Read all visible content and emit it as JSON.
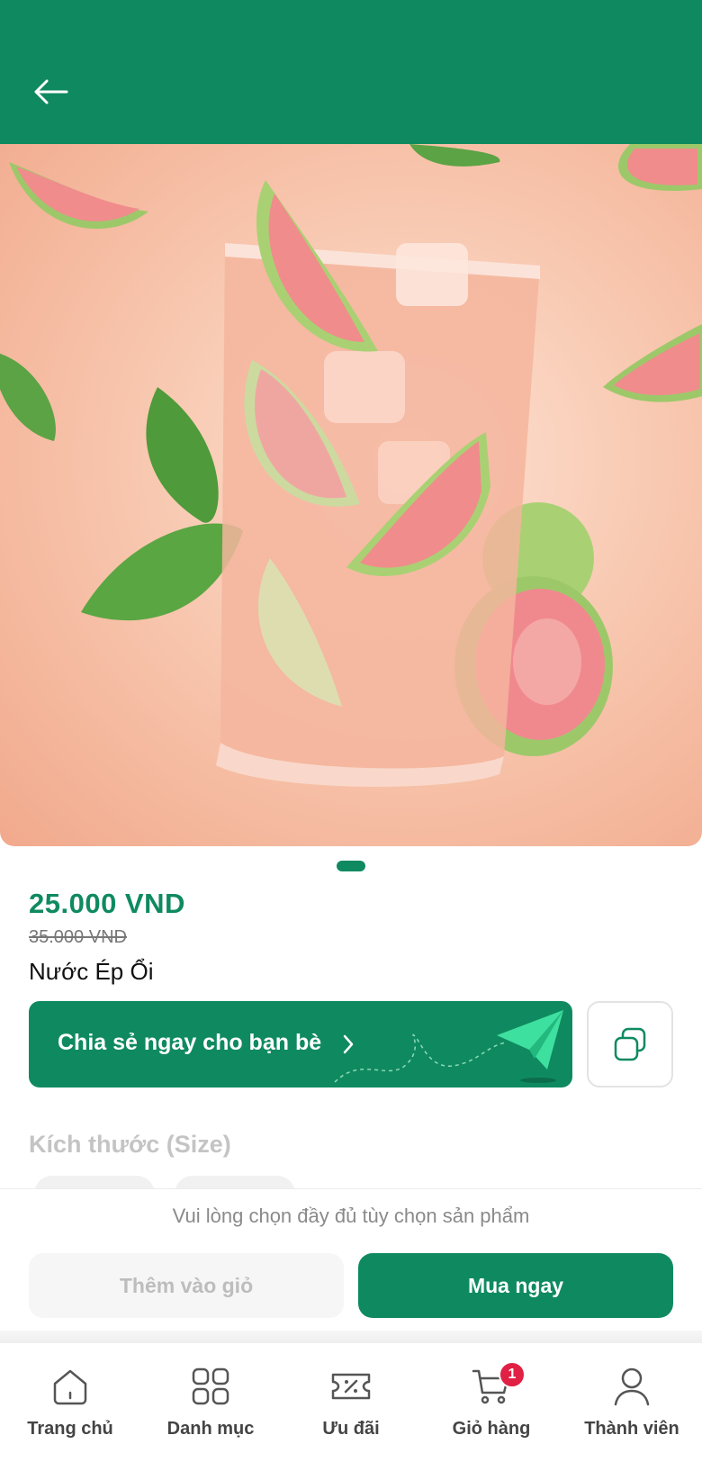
{
  "header": {
    "back_icon": "arrow-left-icon"
  },
  "product": {
    "image_alt": "Guava juice glass with guava slices",
    "price": "25.000 VND",
    "old_price": "35.000 VND",
    "name": "Nước Ép Ổi"
  },
  "share": {
    "label": "Chia sẻ ngay cho bạn bè",
    "icon": "paper-plane-icon",
    "copy_icon": "copy-icon"
  },
  "options": {
    "size_title": "Kích thước (Size)"
  },
  "actions": {
    "hint": "Vui lòng chọn đầy đủ tùy chọn sản phẩm",
    "add_to_cart": "Thêm vào giỏ",
    "buy_now": "Mua ngay"
  },
  "nav": {
    "items": [
      {
        "label": "Trang chủ",
        "icon": "home-icon"
      },
      {
        "label": "Danh mục",
        "icon": "grid-icon"
      },
      {
        "label": "Ưu đãi",
        "icon": "voucher-icon"
      },
      {
        "label": "Giỏ hàng",
        "icon": "cart-icon",
        "badge": "1"
      },
      {
        "label": "Thành viên",
        "icon": "user-icon"
      }
    ]
  },
  "colors": {
    "brand": "#0f8a60",
    "badge": "#e02045"
  }
}
